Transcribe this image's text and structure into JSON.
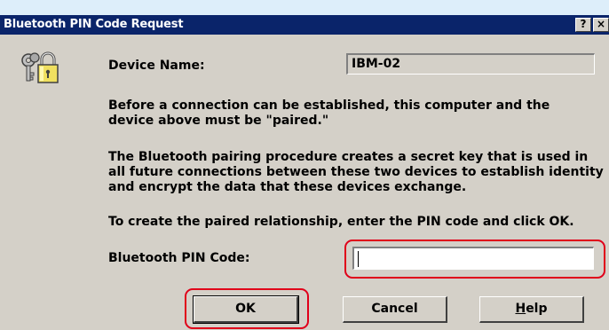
{
  "window": {
    "title": "Bluetooth PIN Code Request",
    "help_button": "?",
    "close_button": "×"
  },
  "device": {
    "label": "Device Name:",
    "value": "IBM-02"
  },
  "text": {
    "para1_line1": "Before a connection can be established, this computer and the",
    "para1_line2": "device above must be \"paired.\"",
    "para2_line1": "The Bluetooth pairing procedure creates a secret key that is used in",
    "para2_line2": "all future connections between these two devices to establish identity",
    "para2_line3": "and encrypt the data that these devices exchange.",
    "para3": "To create the paired relationship, enter the PIN code and click OK."
  },
  "pin": {
    "label": "Bluetooth PIN Code:",
    "value": ""
  },
  "buttons": {
    "ok": "OK",
    "cancel": "Cancel",
    "help_first": "H",
    "help_rest": "elp"
  },
  "icons": {
    "dialog_icon": "keys-and-padlock-icon"
  },
  "colors": {
    "titlebar": "#0a246a",
    "dialog_bg": "#d4d0c8",
    "highlight": "#e0001a"
  }
}
